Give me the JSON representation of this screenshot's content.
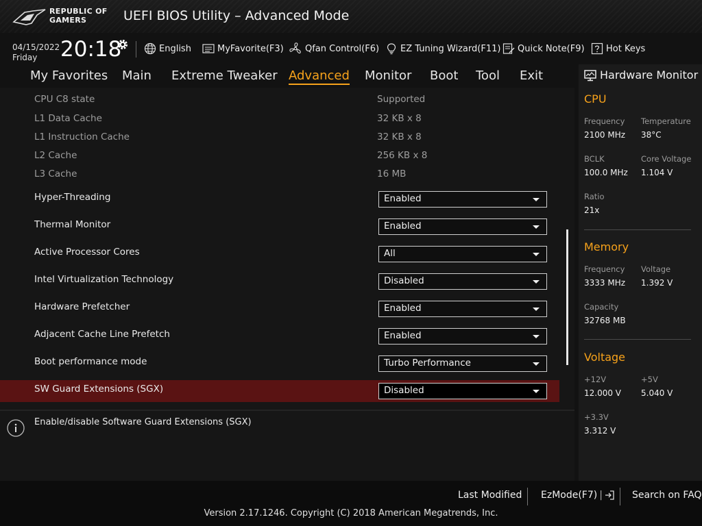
{
  "header": {
    "logo_line1": "REPUBLIC OF",
    "logo_line2": "GAMERS",
    "title": "UEFI BIOS Utility – Advanced Mode"
  },
  "toolbar": {
    "date": "04/15/2022",
    "day": "Friday",
    "time": "20:18",
    "language": "English",
    "myfavorite": "MyFavorite(F3)",
    "qfan": "Qfan Control(F6)",
    "ez_tuning": "EZ Tuning Wizard(F11)",
    "quick_note": "Quick Note(F9)",
    "hot_keys": "Hot Keys"
  },
  "tabs": [
    {
      "label": "My Favorites",
      "active": false
    },
    {
      "label": "Main",
      "active": false
    },
    {
      "label": "Extreme Tweaker",
      "active": false
    },
    {
      "label": "Advanced",
      "active": true
    },
    {
      "label": "Monitor",
      "active": false
    },
    {
      "label": "Boot",
      "active": false
    },
    {
      "label": "Tool",
      "active": false
    },
    {
      "label": "Exit",
      "active": false
    }
  ],
  "info_rows": [
    {
      "label": "CPU C8 state",
      "value": "Supported"
    },
    {
      "label": "L1 Data Cache",
      "value": "32 KB x 8"
    },
    {
      "label": "L1 Instruction Cache",
      "value": "32 KB x 8"
    },
    {
      "label": "L2 Cache",
      "value": "256 KB x 8"
    },
    {
      "label": "L3 Cache",
      "value": "16 MB"
    }
  ],
  "settings": [
    {
      "label": "Hyper-Threading",
      "value": "Enabled"
    },
    {
      "label": "Thermal Monitor",
      "value": "Enabled"
    },
    {
      "label": "Active Processor Cores",
      "value": "All"
    },
    {
      "label": "Intel Virtualization Technology",
      "value": "Disabled"
    },
    {
      "label": "Hardware Prefetcher",
      "value": "Enabled"
    },
    {
      "label": "Adjacent Cache Line Prefetch",
      "value": "Enabled"
    },
    {
      "label": "Boot performance mode",
      "value": "Turbo Performance"
    },
    {
      "label": "SW Guard Extensions (SGX)",
      "value": "Disabled",
      "selected": true
    }
  ],
  "help_text": "Enable/disable Software Guard Extensions (SGX)",
  "hardware_monitor": {
    "title": "Hardware Monitor",
    "cpu": {
      "heading": "CPU",
      "frequency_label": "Frequency",
      "frequency": "2100 MHz",
      "temperature_label": "Temperature",
      "temperature": "38°C",
      "bclk_label": "BCLK",
      "bclk": "100.0 MHz",
      "core_voltage_label": "Core Voltage",
      "core_voltage": "1.104 V",
      "ratio_label": "Ratio",
      "ratio": "21x"
    },
    "memory": {
      "heading": "Memory",
      "frequency_label": "Frequency",
      "frequency": "3333 MHz",
      "voltage_label": "Voltage",
      "voltage": "1.392 V",
      "capacity_label": "Capacity",
      "capacity": "32768 MB"
    },
    "voltage": {
      "heading": "Voltage",
      "v12_label": "+12V",
      "v12": "12.000 V",
      "v5_label": "+5V",
      "v5": "5.040 V",
      "v33_label": "+3.3V",
      "v33": "3.312 V"
    }
  },
  "footer": {
    "last_modified": "Last Modified",
    "ezmode": "EzMode(F7)",
    "search_faq": "Search on FAQ",
    "copyright": "Version 2.17.1246. Copyright (C) 2018 American Megatrends, Inc."
  },
  "colors": {
    "accent": "#f7a21b",
    "highlight_row": "#5a1313",
    "background": "#121212"
  }
}
